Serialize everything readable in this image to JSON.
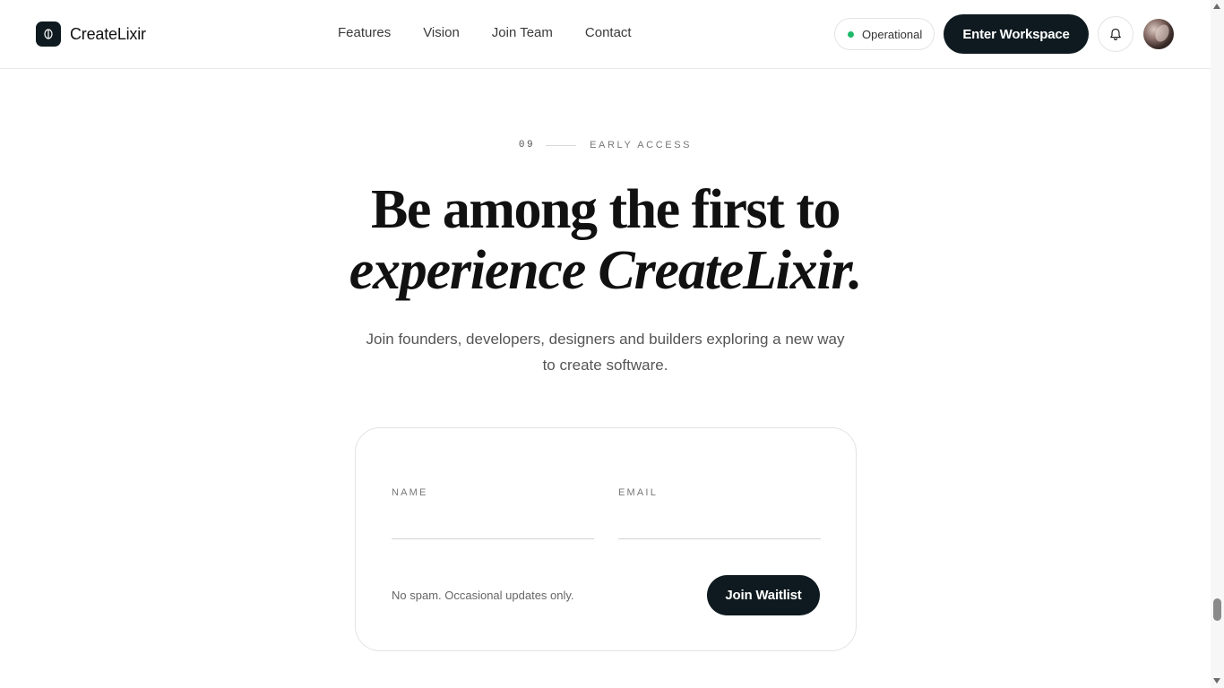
{
  "header": {
    "brand": "CreateLixir",
    "nav": [
      "Features",
      "Vision",
      "Join Team",
      "Contact"
    ],
    "status": "Operational",
    "cta": "Enter Workspace",
    "icons": {
      "logo": "logo-mark-icon",
      "bell": "bell-icon",
      "avatar": "user-avatar"
    },
    "colors": {
      "status_dot": "#1fb96b",
      "brand_dark": "#0e1a1f"
    }
  },
  "section": {
    "number": "09",
    "label": "EARLY ACCESS",
    "headline_line1": "Be among the first to",
    "headline_line2": "experience CreateLixir.",
    "subtext": "Join founders, developers, designers and builders exploring a new way to create software."
  },
  "form": {
    "name_label": "NAME",
    "name_value": "",
    "email_label": "EMAIL",
    "email_value": "",
    "note": "No spam. Occasional updates only.",
    "submit": "Join Waitlist"
  }
}
